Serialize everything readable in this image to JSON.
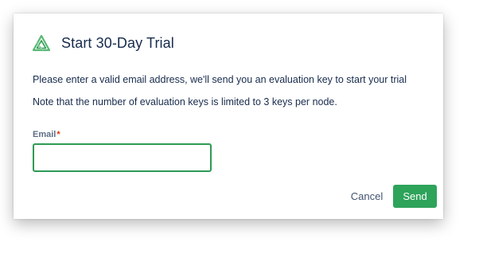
{
  "dialog": {
    "title": "Start 30-Day Trial",
    "logo_icon": "triangle-logo-icon",
    "description_1": "Please enter a valid email address, we'll send you an evaluation key to start your trial",
    "description_2": "Note that the number of evaluation keys is limited to 3 keys per node.",
    "email": {
      "label": "Email",
      "required_mark": "*",
      "value": "",
      "placeholder": ""
    },
    "buttons": {
      "cancel_label": "Cancel",
      "send_label": "Send"
    }
  },
  "colors": {
    "accent_green": "#2ea35a",
    "input_border": "#2e9b55",
    "required_red": "#de350b",
    "text_primary": "#172b4d",
    "label_gray": "#5e6c84"
  }
}
